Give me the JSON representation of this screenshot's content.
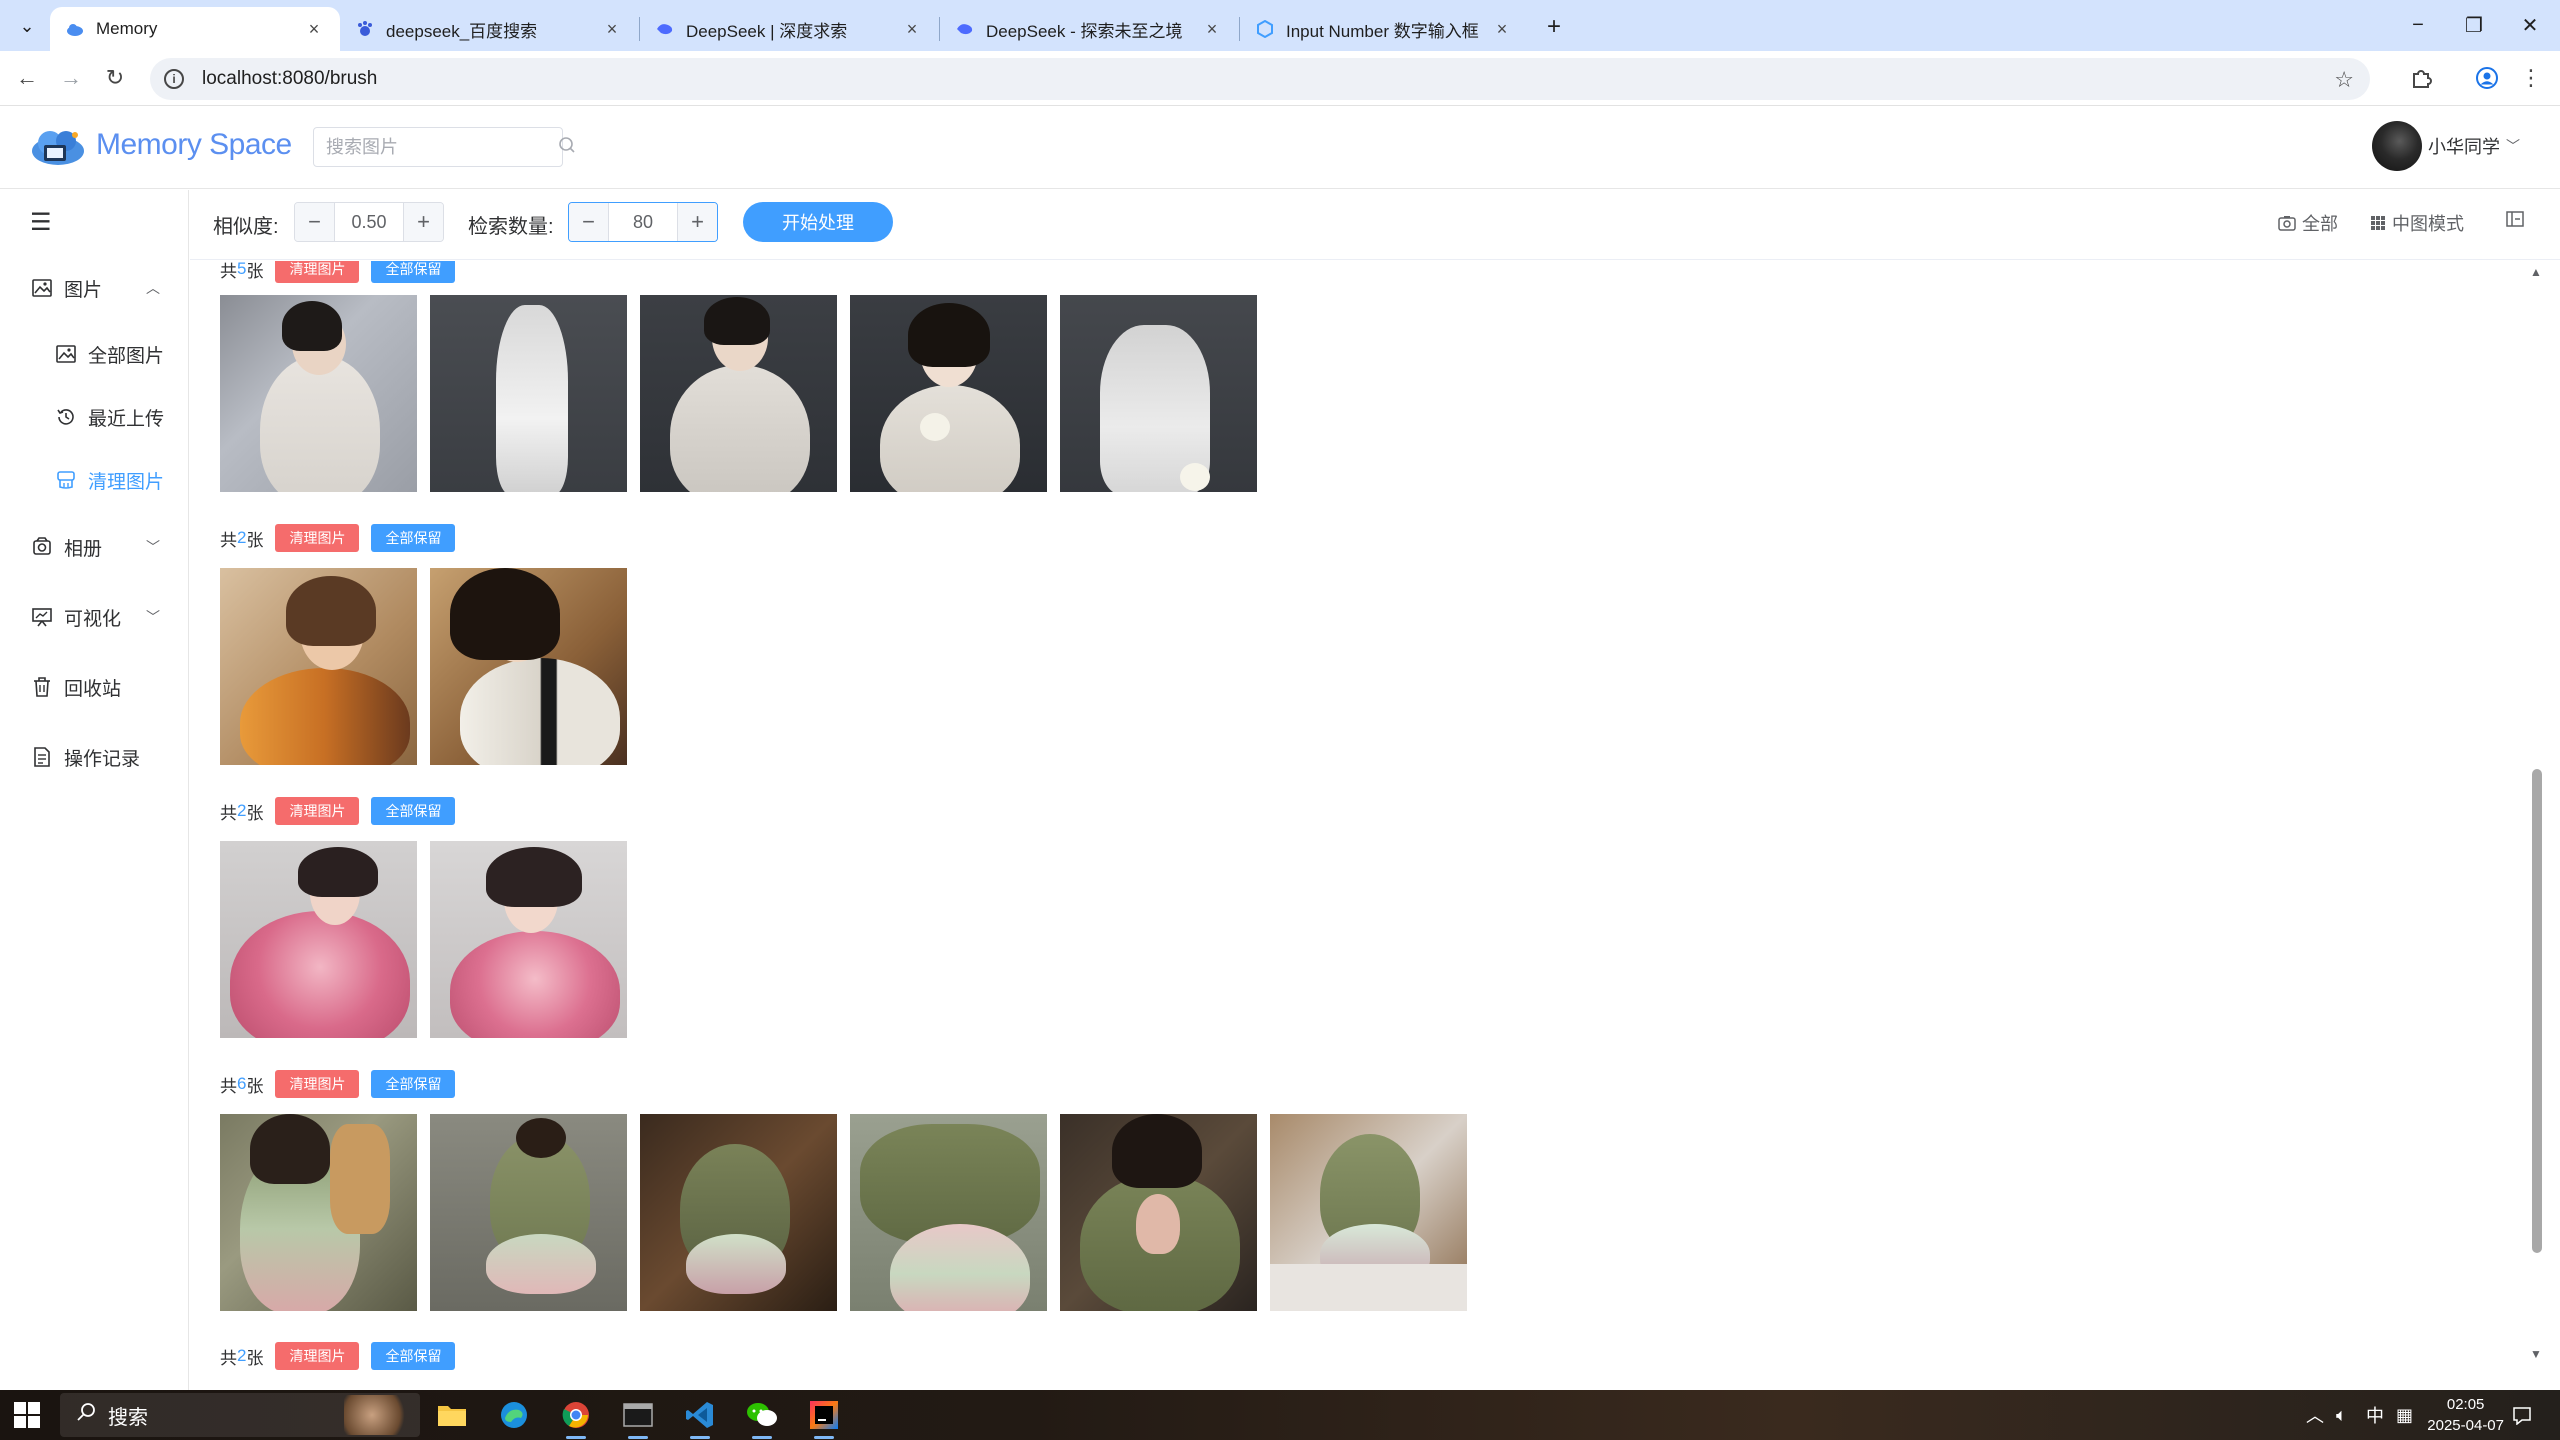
{
  "browser": {
    "tabs": [
      {
        "title": "Memory",
        "active": true
      },
      {
        "title": "deepseek_百度搜索",
        "active": false
      },
      {
        "title": "DeepSeek | 深度求索",
        "active": false
      },
      {
        "title": "DeepSeek - 探索未至之境",
        "active": false
      },
      {
        "title": "Input Number 数字输入框 | El",
        "active": false
      }
    ],
    "url": "localhost:8080/brush"
  },
  "header": {
    "logo_text": "Memory Space",
    "search_placeholder": "搜索图片",
    "user_name": "小华同学"
  },
  "sidebar": {
    "items": [
      {
        "label": "图片",
        "icon": "picture-icon",
        "expanded": true
      },
      {
        "label": "全部图片",
        "icon": "picture-icon",
        "sub": true
      },
      {
        "label": "最近上传",
        "icon": "history-icon",
        "sub": true
      },
      {
        "label": "清理图片",
        "icon": "brush-icon",
        "sub": true,
        "active": true
      },
      {
        "label": "相册",
        "icon": "album-icon",
        "expanded": false
      },
      {
        "label": "可视化",
        "icon": "chart-icon",
        "expanded": false
      },
      {
        "label": "回收站",
        "icon": "trash-icon"
      },
      {
        "label": "操作记录",
        "icon": "document-icon"
      }
    ]
  },
  "toolbar": {
    "similarity_label": "相似度:",
    "similarity_value": "0.50",
    "count_label": "检索数量:",
    "count_value": "80",
    "start_label": "开始处理",
    "all_label": "全部",
    "view_mode_label": "中图模式"
  },
  "groups": [
    {
      "prefix": "共",
      "count": "5",
      "suffix": "张",
      "clean_label": "清理图片",
      "keep_label": "全部保留",
      "image_count": 5
    },
    {
      "prefix": "共",
      "count": "2",
      "suffix": "张",
      "clean_label": "清理图片",
      "keep_label": "全部保留",
      "image_count": 2
    },
    {
      "prefix": "共",
      "count": "2",
      "suffix": "张",
      "clean_label": "清理图片",
      "keep_label": "全部保留",
      "image_count": 2
    },
    {
      "prefix": "共",
      "count": "6",
      "suffix": "张",
      "clean_label": "清理图片",
      "keep_label": "全部保留",
      "image_count": 6
    },
    {
      "prefix": "共",
      "count": "2",
      "suffix": "张",
      "clean_label": "清理图片",
      "keep_label": "全部保留",
      "image_count": 0
    }
  ],
  "taskbar": {
    "search_label": "搜索",
    "ime": "中",
    "time": "02:05",
    "date": "2025-04-07"
  },
  "colors": {
    "primary": "#409eff",
    "danger": "#f56c6c",
    "tabbar": "#d3e3fd"
  }
}
